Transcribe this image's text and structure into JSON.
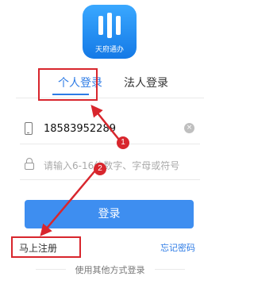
{
  "app": {
    "logo_text": "天府通办"
  },
  "tabs": [
    {
      "label": "个人登录",
      "active": true
    },
    {
      "label": "法人登录",
      "active": false
    }
  ],
  "form": {
    "phone_value": "18583952289",
    "password_placeholder": "请输入6-16位数字、字母或符号",
    "login_label": "登录"
  },
  "links": {
    "register": "马上注册",
    "forgot": "忘记密码"
  },
  "footer": {
    "other_methods": "使用其他方式登录"
  },
  "annotations": {
    "marker_1": "1",
    "marker_2": "2",
    "color": "#d8262d"
  },
  "colors": {
    "accent": "#2d7be5",
    "button": "#3e8ef0"
  },
  "icons": [
    "phone-icon",
    "clear-icon",
    "lock-icon"
  ]
}
